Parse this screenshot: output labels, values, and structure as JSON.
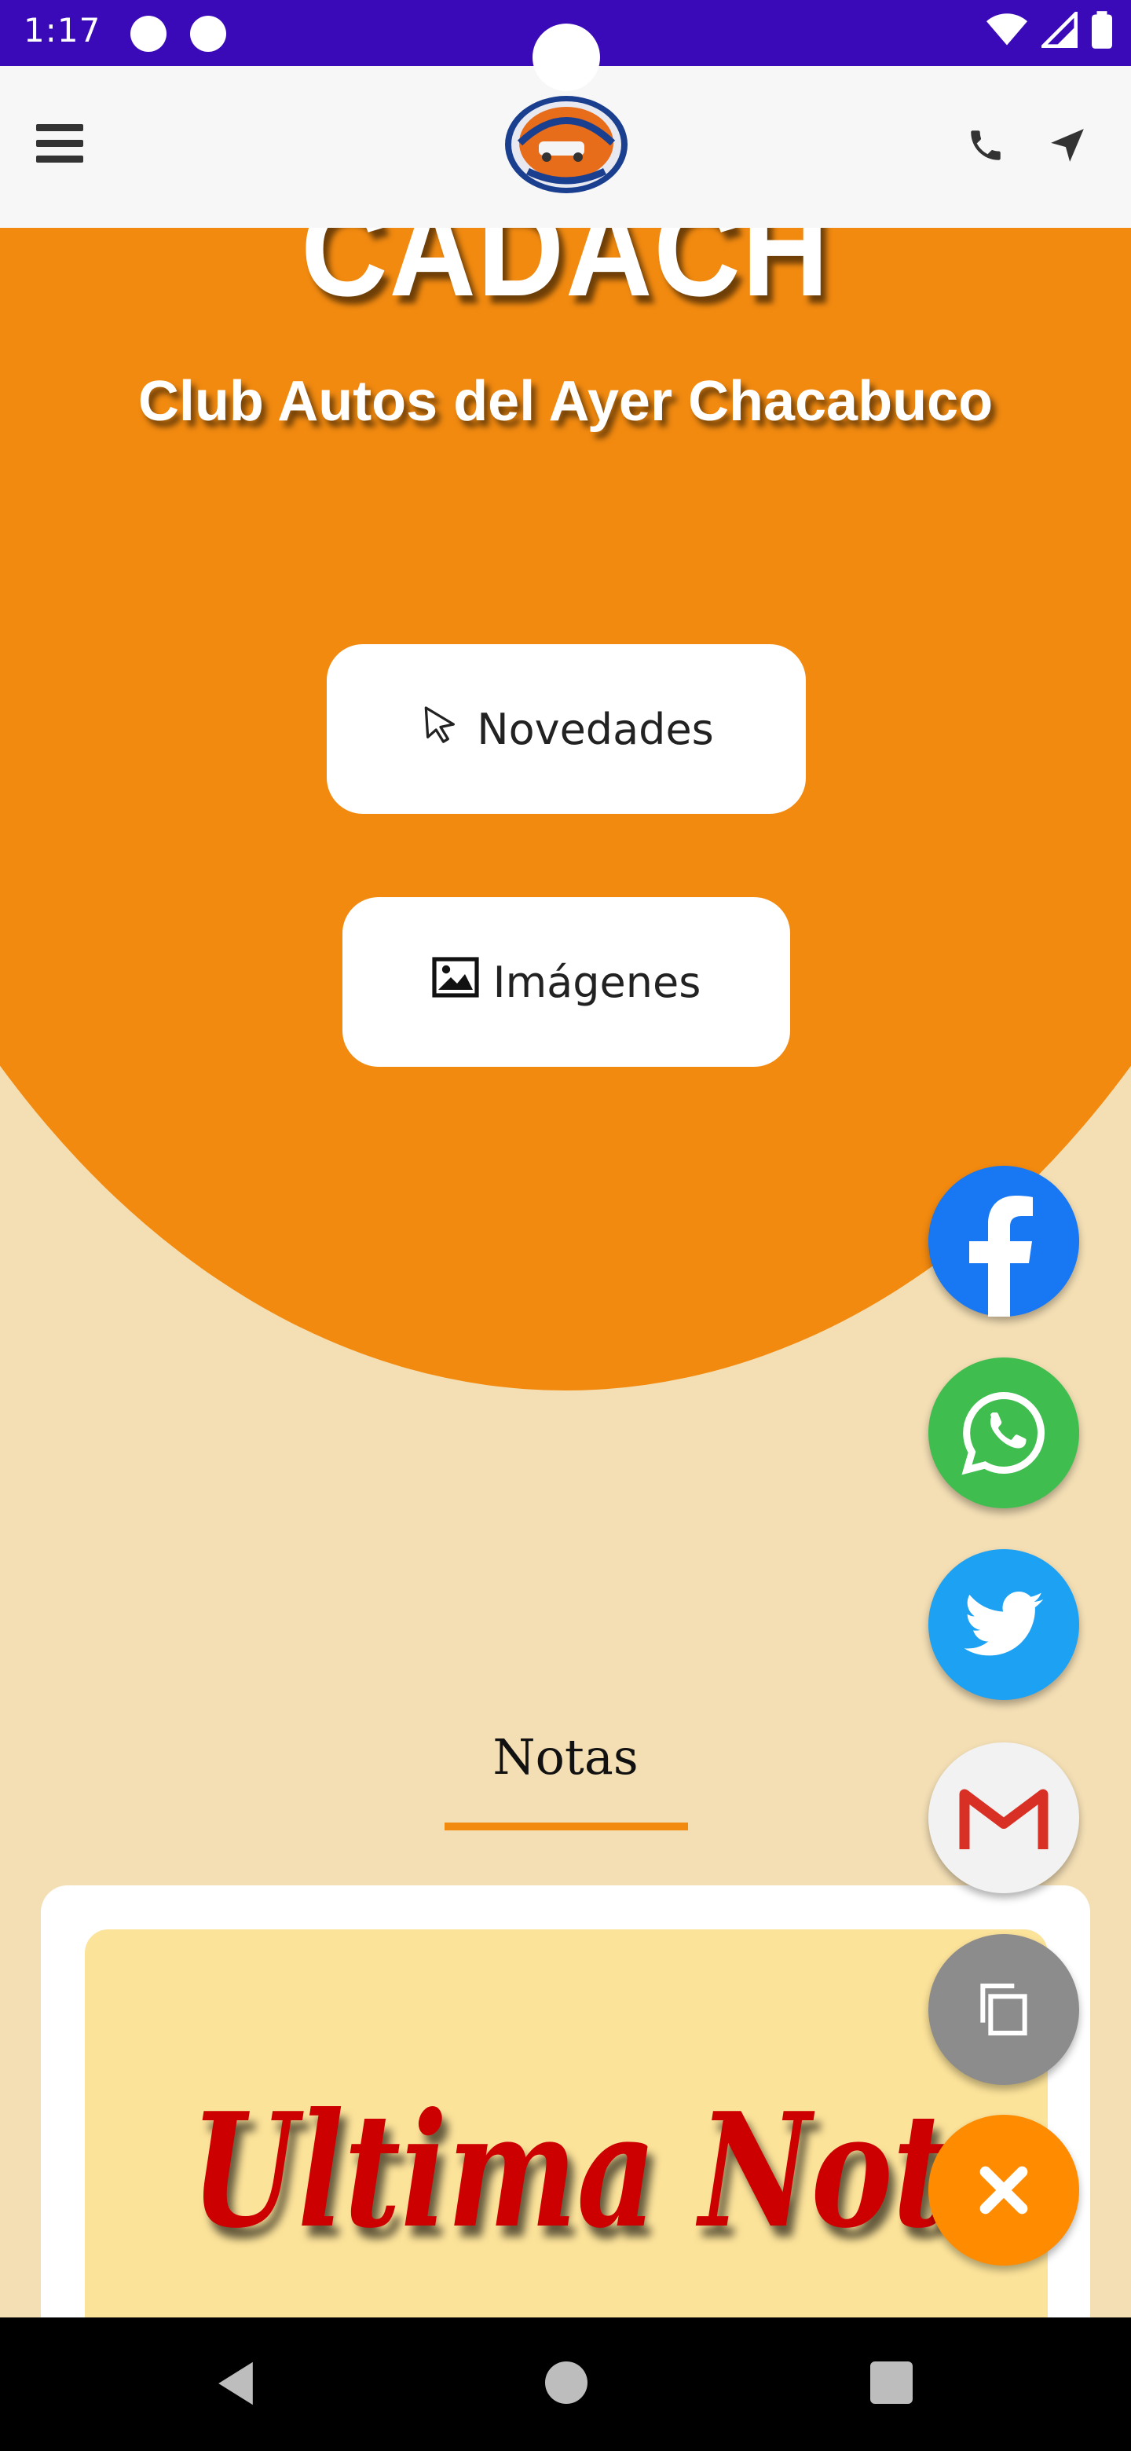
{
  "status_bar": {
    "time": "1:17"
  },
  "header": {
    "logo_alt": "Club Autos del Ayer Chacabuco logo"
  },
  "hero": {
    "title": "CADACH",
    "subtitle": "Club Autos del Ayer Chacabuco",
    "buttons": [
      {
        "label": "Novedades",
        "icon": "cursor-icon"
      },
      {
        "label": "Imágenes",
        "icon": "image-icon"
      }
    ]
  },
  "notas": {
    "title": "Notas",
    "card_banner": "Ultima Nota"
  },
  "social": {
    "items": [
      "facebook",
      "whatsapp",
      "twitter",
      "gmail",
      "copy",
      "close"
    ]
  },
  "colors": {
    "status_bar": "#3a0ab8",
    "hero_orange": "#f28a10",
    "page_bg": "#f4dfb5",
    "banner_red": "#cc0000"
  }
}
